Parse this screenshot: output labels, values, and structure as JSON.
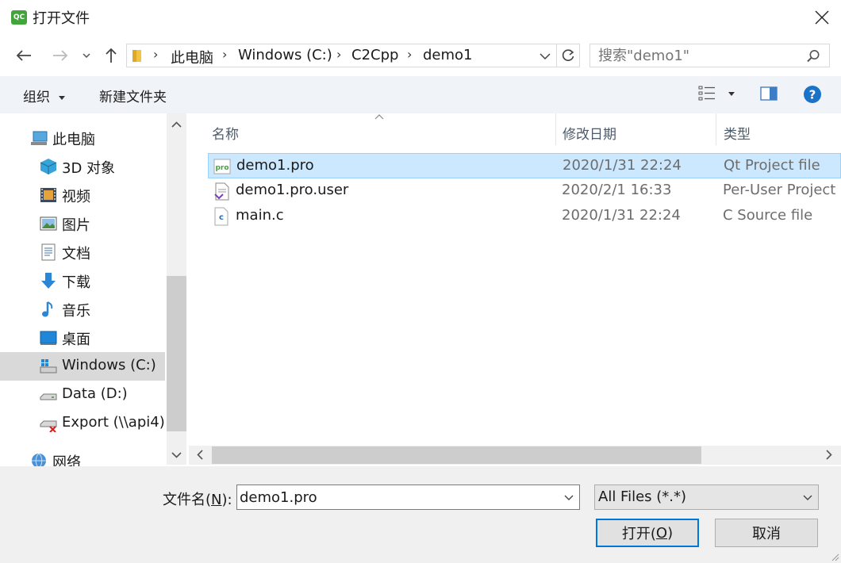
{
  "window": {
    "app_icon_text": "QC",
    "title": "打开文件"
  },
  "address": {
    "crumbs": [
      "此电脑",
      "Windows (C:)",
      "C2Cpp",
      "demo1"
    ]
  },
  "search": {
    "placeholder": "搜索\"demo1\""
  },
  "toolbar": {
    "organize_label": "组织",
    "new_folder_label": "新建文件夹"
  },
  "sidebar": {
    "items": [
      {
        "label": "此电脑",
        "icon": "computer-icon"
      },
      {
        "label": "3D 对象",
        "icon": "cube-3d-icon"
      },
      {
        "label": "视频",
        "icon": "video-icon"
      },
      {
        "label": "图片",
        "icon": "pictures-icon"
      },
      {
        "label": "文档",
        "icon": "document-icon"
      },
      {
        "label": "下载",
        "icon": "download-icon"
      },
      {
        "label": "音乐",
        "icon": "music-icon"
      },
      {
        "label": "桌面",
        "icon": "desktop-icon"
      },
      {
        "label": "Windows (C:)",
        "icon": "drive-windows-icon",
        "selected": true
      },
      {
        "label": "Data (D:)",
        "icon": "drive-icon"
      },
      {
        "label": "Export (\\\\api4)",
        "icon": "network-drive-disconnected-icon"
      },
      {
        "label": "网络",
        "icon": "network-icon"
      }
    ]
  },
  "file_list": {
    "columns": [
      "名称",
      "修改日期",
      "类型"
    ],
    "rows": [
      {
        "name": "demo1.pro",
        "date": "2020/1/31 22:24",
        "type": "Qt Project file",
        "icon_text": "pro",
        "selected": true
      },
      {
        "name": "demo1.pro.user",
        "date": "2020/2/1 16:33",
        "type": "Per-User Project (",
        "icon_text": ""
      },
      {
        "name": "main.c",
        "date": "2020/1/31 22:24",
        "type": "C Source file",
        "icon_text": "c"
      }
    ]
  },
  "bottom": {
    "filename_label": "文件名(",
    "filename_mnemonic": "N",
    "filename_label_end": "):",
    "filename_value": "demo1.pro",
    "filter_value": "All Files (*.*)",
    "open_label": "打开(",
    "open_mnemonic": "O",
    "open_label_end": ")",
    "cancel_label": "取消"
  },
  "colors": {
    "selection": "#cce8ff",
    "accent": "#0078d7",
    "help": "#1a72c9"
  }
}
